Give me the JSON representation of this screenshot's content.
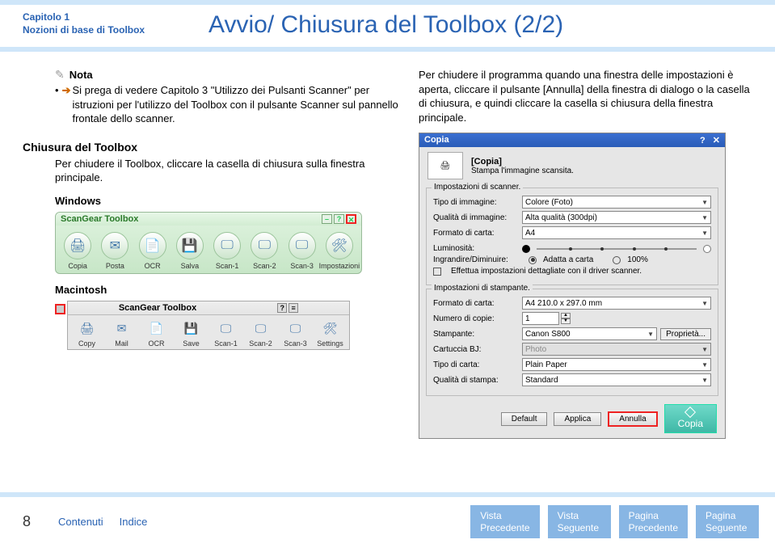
{
  "header": {
    "chapter_line1": "Capitolo 1",
    "chapter_line2": "Nozioni di base di Toolbox",
    "title": "Avvio/ Chiusura del Toolbox (2/2)"
  },
  "note": {
    "heading": "Nota",
    "body": "Si prega di vedere Capitolo 3 \"Utilizzo dei Pulsanti Scanner\" per istruzioni per l'utilizzo del Toolbox con il pulsante Scanner sul pannello frontale dello scanner."
  },
  "close_section": {
    "title": "Chiusura del Toolbox",
    "body": "Per chiudere il Toolbox, cliccare la casella di chiusura sulla finestra principale.",
    "win_heading": "Windows",
    "mac_heading": "Macintosh"
  },
  "toolbox_win": {
    "title": "ScanGear Toolbox",
    "icons": [
      {
        "glyph": "🖨",
        "label": "Copia"
      },
      {
        "glyph": "✉",
        "label": "Posta"
      },
      {
        "glyph": "📄",
        "label": "OCR"
      },
      {
        "glyph": "💾",
        "label": "Salva"
      },
      {
        "glyph": "🖵",
        "label": "Scan-1"
      },
      {
        "glyph": "🖵",
        "label": "Scan-2"
      },
      {
        "glyph": "🖵",
        "label": "Scan-3"
      },
      {
        "glyph": "🛠",
        "label": "Impostazioni"
      }
    ]
  },
  "toolbox_mac": {
    "title": "ScanGear Toolbox",
    "icons": [
      {
        "glyph": "🖨",
        "label": "Copy"
      },
      {
        "glyph": "✉",
        "label": "Mail"
      },
      {
        "glyph": "📄",
        "label": "OCR"
      },
      {
        "glyph": "💾",
        "label": "Save"
      },
      {
        "glyph": "🖵",
        "label": "Scan-1"
      },
      {
        "glyph": "🖵",
        "label": "Scan-2"
      },
      {
        "glyph": "🖵",
        "label": "Scan-3"
      },
      {
        "glyph": "🛠",
        "label": "Settings"
      }
    ]
  },
  "right_text": "Per chiudere il programma quando una finestra delle impostazioni è aperta, cliccare il pulsante [Annulla] della finestra di dialogo o la casella di chiusura, e quindi cliccare la casella si chiusura della finestra principale.",
  "dialog": {
    "title": "Copia",
    "help_x": "? | ✕",
    "head_label": "[Copia]",
    "head_sub": "Stampa l'immagine scansita.",
    "scanner_group": "Impostazioni di scanner.",
    "tipo_img_label": "Tipo di immagine:",
    "tipo_img_val": "Colore (Foto)",
    "qualita_img_label": "Qualità di immagine:",
    "qualita_img_val": "Alta qualità (300dpi)",
    "formato_carta_label": "Formato di carta:",
    "formato_carta_val": "A4",
    "luminosita_label": "Luminosità:",
    "ingrandire_label": "Ingrandire/Diminuire:",
    "radio_adatta": "Adatta a carta",
    "radio_100": "100%",
    "effettua": "Effettua impostazioni dettagliate con il driver scanner.",
    "printer_group": "Impostazioni di stampante.",
    "formato_carta2_label": "Formato di carta:",
    "formato_carta2_val": "A4 210.0 x 297.0 mm",
    "num_copie_label": "Numero di copie:",
    "num_copie_val": "1",
    "stampante_label": "Stampante:",
    "stampante_val": "Canon S800",
    "proprieta": "Proprietà...",
    "cartuccia_label": "Cartuccia BJ:",
    "cartuccia_val": "Photo",
    "tipo_carta_label": "Tipo di carta:",
    "tipo_carta_val": "Plain Paper",
    "qualita_stampa_label": "Qualità di stampa:",
    "qualita_stampa_val": "Standard",
    "btn_default": "Default",
    "btn_applica": "Applica",
    "btn_annulla": "Annulla",
    "btn_copia": "Copia"
  },
  "footer": {
    "page": "8",
    "contenuti": "Contenuti",
    "indice": "Indice",
    "vista_prec": "Vista\nPrecedente",
    "vista_seg": "Vista\nSeguente",
    "pagina_prec": "Pagina\nPrecedente",
    "pagina_seg": "Pagina\nSeguente"
  }
}
